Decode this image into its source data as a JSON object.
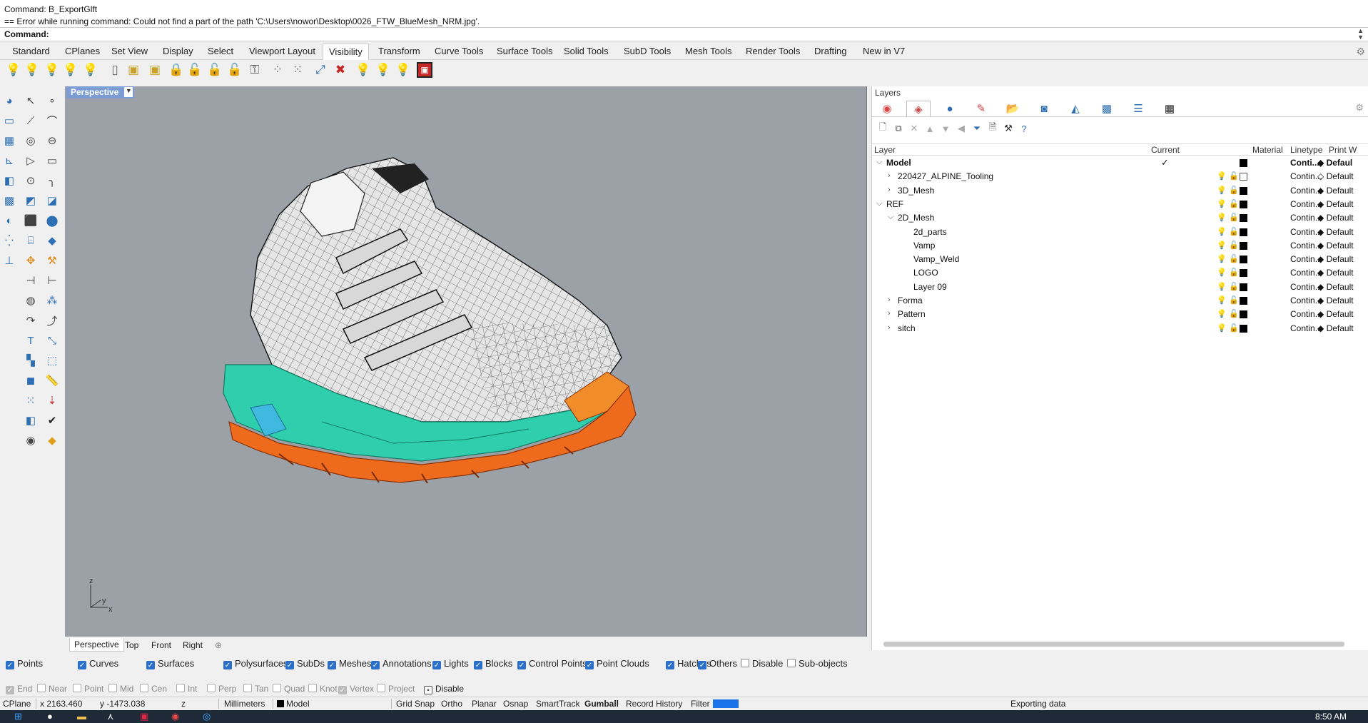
{
  "command": {
    "line1": "Command: B_ExportGlft",
    "line2": "== Error while running command: Could not find a part of the path 'C:\\Users\\nowor\\Desktop\\0026_FTW_BlueMesh_NRM.jpg'.",
    "prompt_label": "Command:"
  },
  "tabs": [
    "Standard",
    "CPlanes",
    "Set View",
    "Display",
    "Select",
    "Viewport Layout",
    "Visibility",
    "Transform",
    "Curve Tools",
    "Surface Tools",
    "Solid Tools",
    "SubD Tools",
    "Mesh Tools",
    "Render Tools",
    "Drafting",
    "New in V7"
  ],
  "active_tab": "Visibility",
  "viewport": {
    "title": "Perspective",
    "tabs": [
      "Perspective",
      "Top",
      "Front",
      "Right"
    ],
    "axis_labels": {
      "z": "z",
      "x": "x",
      "y": "y"
    }
  },
  "layers_panel": {
    "title": "Layers",
    "columns": {
      "layer": "Layer",
      "current": "Current",
      "material": "Material",
      "linetype": "Linetype",
      "print_width": "Print W"
    },
    "rows": [
      {
        "name": "Model",
        "level": 0,
        "expanded": true,
        "bold": true,
        "current": true,
        "linetype": "Conti...",
        "print": "Defaul",
        "white_swatch": false
      },
      {
        "name": "220427_ALPINE_Tooling",
        "level": 1,
        "expander": ">",
        "linetype": "Contin...",
        "print": "Default",
        "white_swatch": true
      },
      {
        "name": "3D_Mesh",
        "level": 1,
        "expander": ">",
        "linetype": "Contin...",
        "print": "Default",
        "white_swatch": false
      },
      {
        "name": "REF",
        "level": 0,
        "expander": "v",
        "linetype": "Contin...",
        "print": "Default",
        "white_swatch": false
      },
      {
        "name": "2D_Mesh",
        "level": 1,
        "expander": "v",
        "linetype": "Contin...",
        "print": "Default",
        "white_swatch": false
      },
      {
        "name": "2d_parts",
        "level": 2,
        "linetype": "Contin...",
        "print": "Default",
        "white_swatch": false
      },
      {
        "name": "Vamp",
        "level": 2,
        "linetype": "Contin...",
        "print": "Default",
        "white_swatch": false
      },
      {
        "name": "Vamp_Weld",
        "level": 2,
        "linetype": "Contin...",
        "print": "Default",
        "white_swatch": false
      },
      {
        "name": "LOGO",
        "level": 2,
        "linetype": "Contin...",
        "print": "Default",
        "white_swatch": false
      },
      {
        "name": "Layer 09",
        "level": 2,
        "linetype": "Contin...",
        "print": "Default",
        "white_swatch": false
      },
      {
        "name": "Forma",
        "level": 1,
        "expander": ">",
        "linetype": "Contin...",
        "print": "Default",
        "white_swatch": false
      },
      {
        "name": "Pattern",
        "level": 1,
        "expander": ">",
        "linetype": "Contin...",
        "print": "Default",
        "white_swatch": false
      },
      {
        "name": "sitch",
        "level": 1,
        "expander": ">",
        "linetype": "Contin...",
        "print": "Default",
        "white_swatch": false
      }
    ]
  },
  "filters": [
    {
      "label": "Points",
      "on": true
    },
    {
      "label": "Curves",
      "on": true
    },
    {
      "label": "Surfaces",
      "on": true
    },
    {
      "label": "Polysurfaces",
      "on": true
    },
    {
      "label": "SubDs",
      "on": true
    },
    {
      "label": "Meshes",
      "on": true
    },
    {
      "label": "Annotations",
      "on": true
    },
    {
      "label": "Lights",
      "on": true
    },
    {
      "label": "Blocks",
      "on": true
    },
    {
      "label": "Control Points",
      "on": true
    },
    {
      "label": "Point Clouds",
      "on": true
    },
    {
      "label": "Hatches",
      "on": true
    },
    {
      "label": "Others",
      "on": true
    },
    {
      "label": "Disable",
      "on": false
    },
    {
      "label": "Sub-objects",
      "on": false
    }
  ],
  "osnaps": [
    {
      "label": "End",
      "on": true
    },
    {
      "label": "Near",
      "on": false
    },
    {
      "label": "Point",
      "on": false
    },
    {
      "label": "Mid",
      "on": false
    },
    {
      "label": "Cen",
      "on": false
    },
    {
      "label": "Int",
      "on": false
    },
    {
      "label": "Perp",
      "on": false
    },
    {
      "label": "Tan",
      "on": false
    },
    {
      "label": "Quad",
      "on": false
    },
    {
      "label": "Knot",
      "on": false
    },
    {
      "label": "Vertex",
      "on": true
    },
    {
      "label": "Project",
      "on": false
    },
    {
      "label": "Disable",
      "on": true
    }
  ],
  "status": {
    "cplane": "CPlane",
    "x": "x 2163.460",
    "y": "y -1473.038",
    "z": "z",
    "units": "Millimeters",
    "layer": "Model",
    "grid_snap": "Grid Snap",
    "ortho": "Ortho",
    "planar": "Planar",
    "osnap": "Osnap",
    "smarttrack": "SmartTrack",
    "gumball": "Gumball",
    "record_history": "Record History",
    "filter": "Filter",
    "message": "Exporting data"
  },
  "clock": "8:50 AM",
  "colors": {
    "viewport_bg": "#9ba1a7",
    "title_bg": "#7d9cd3",
    "accent": "#2a6fc9",
    "sole_teal": "#2fcfae",
    "sole_orange": "#ee6a1c"
  }
}
